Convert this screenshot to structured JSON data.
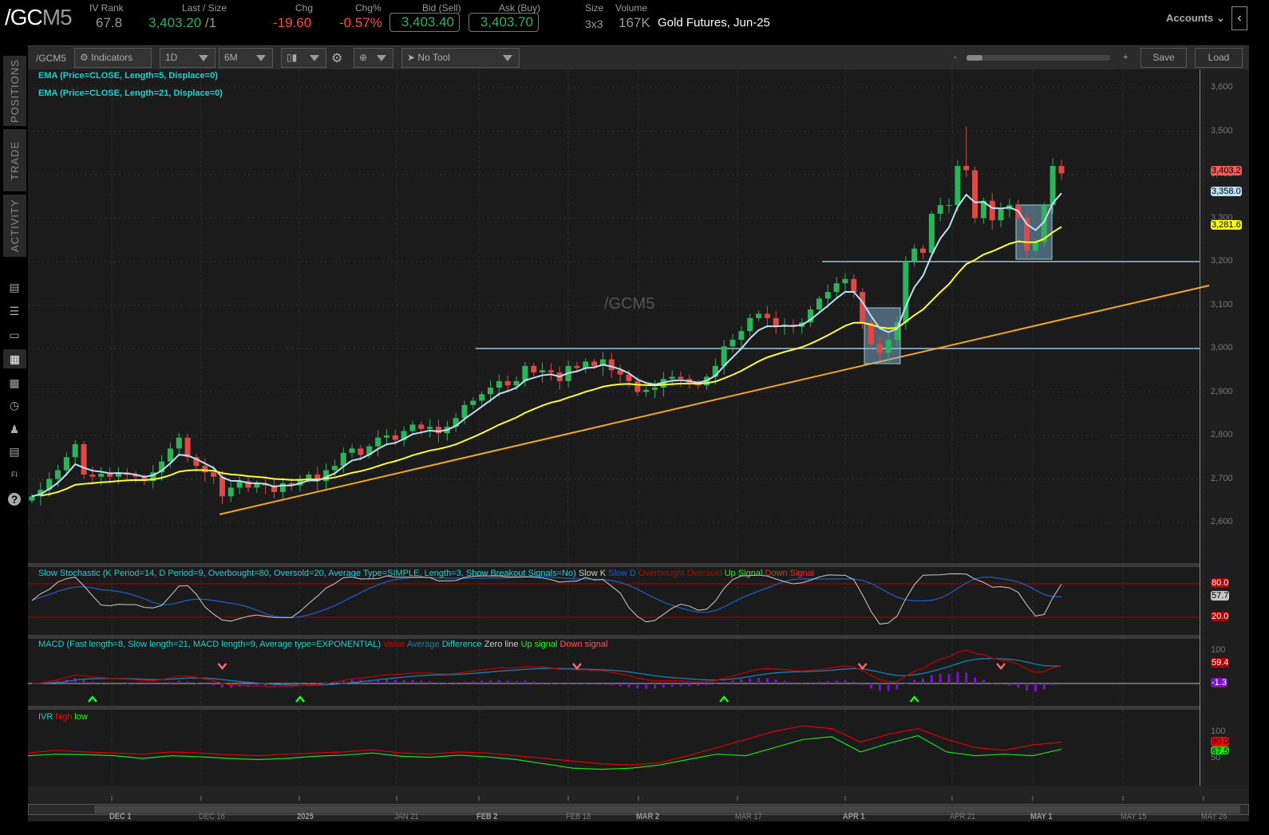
{
  "header": {
    "symbol_main": "/GC",
    "symbol_suffix": "M5",
    "iv_rank_label": "IV Rank",
    "iv_rank": "67.8",
    "last_label": "Last / Size",
    "last": "3,403.20",
    "size": "/1",
    "chg_label": "Chg",
    "chg": "-19.60",
    "chgpct_label": "Chg%",
    "chgpct": "-0.57%",
    "bid_label": "Bid (Sell)",
    "bid": "3,403.40",
    "ask_label": "Ask (Buy)",
    "ask": "3,403.70",
    "sz_label": "Size",
    "sz": "3x3",
    "vol_label": "Volume",
    "vol": "167K",
    "desc": "Gold Futures, Jun-25",
    "accounts": "Accounts"
  },
  "toolbar": {
    "symbol": "/GCM5",
    "indicators": "Indicators",
    "aggregation": "1D",
    "range": "6M",
    "tool": "No Tool",
    "zoom_minus": "-",
    "zoom_plus": "+",
    "save": "Save",
    "load": "Load"
  },
  "sidebar": {
    "tabs": [
      "POSITIONS",
      "TRADE",
      "ACTIVITY"
    ]
  },
  "studies": {
    "ema5": "EMA (Price=CLOSE, Length=5, Displace=0)",
    "ema21": "EMA (Price=CLOSE, Length=21, Displace=0)",
    "watermark": "/GCM5",
    "stoch": "Slow Stochastic (K Period=14, D Period=9, Overbought=80, Oversold=20, Average Type=SIMPLE, Length=3, Show Breakout Signals=No)",
    "stoch_legend": [
      "Slow K",
      "Slow D",
      "Overbought",
      "Oversold",
      "Up Signal",
      "Down Signal"
    ],
    "macd": "MACD (Fast length=8, Slow length=21, MACD length=9, Average type=EXPONENTIAL)",
    "macd_legend": [
      "Value",
      "Average",
      "Difference",
      "Zero line",
      "Up signal",
      "Down signal"
    ],
    "ivr": "IVR",
    "ivr_legend": [
      "high",
      "low"
    ]
  },
  "price_axis": {
    "ticks": [
      "3,600",
      "3,500",
      "3,400",
      "3,300",
      "3,200",
      "3,100",
      "3,000",
      "2,900",
      "2,800",
      "2,700",
      "2,600"
    ],
    "last_tag": "3,403.2",
    "ema5_tag": "3,358.0",
    "ema21_tag": "3,281.6"
  },
  "stoch_axis": {
    "ob": "80.0",
    "k": "57.7",
    "os": "20.0"
  },
  "macd_axis": {
    "top": "100",
    "value": "59.4",
    "diff": "-1.3"
  },
  "ivr_axis": {
    "top": "100",
    "mid": "50",
    "high": "80.0",
    "low": "67.5"
  },
  "x_axis": [
    "DEC 1",
    "DEC 16",
    "2025",
    "JAN 21",
    "FEB 2",
    "FEB 18",
    "MAR 2",
    "MAR 17",
    "APR 1",
    "APR 21",
    "MAY 1",
    "MAY 15",
    "MAY 26"
  ],
  "colors": {
    "up": "#2db35a",
    "down": "#e04848",
    "ema5": "#b8e2f2",
    "ema21": "#ffff33",
    "trend": "#f5a623",
    "level": "#7d9bb0"
  },
  "chart_data": {
    "type": "candlestick",
    "title": "/GCM5 Gold Futures, Jun-25 daily",
    "ylim": [
      2550,
      3650
    ],
    "first_open": 2650,
    "closes": [
      2660,
      2675,
      2700,
      2720,
      2750,
      2780,
      2710,
      2705,
      2712,
      2705,
      2715,
      2710,
      2705,
      2695,
      2715,
      2740,
      2770,
      2795,
      2750,
      2730,
      2715,
      2705,
      2660,
      2680,
      2695,
      2680,
      2690,
      2685,
      2670,
      2690,
      2685,
      2700,
      2710,
      2695,
      2720,
      2730,
      2760,
      2770,
      2755,
      2775,
      2795,
      2800,
      2790,
      2810,
      2825,
      2815,
      2820,
      2805,
      2820,
      2840,
      2870,
      2880,
      2895,
      2910,
      2925,
      2915,
      2925,
      2960,
      2945,
      2950,
      2945,
      2925,
      2960,
      2955,
      2970,
      2960,
      2975,
      2950,
      2940,
      2925,
      2900,
      2905,
      2910,
      2930,
      2935,
      2930,
      2920,
      2915,
      2935,
      2960,
      3005,
      3020,
      3040,
      3070,
      3080,
      3070,
      3050,
      3055,
      3050,
      3060,
      3090,
      3115,
      3130,
      3150,
      3160,
      3130,
      3060,
      3010,
      2990,
      3020,
      3060,
      3200,
      3230,
      3220,
      3310,
      3330,
      3330,
      3420,
      3410,
      3300,
      3340,
      3295,
      3320,
      3330,
      3300,
      3225,
      3245,
      3330,
      3420,
      3403
    ],
    "high_spikes": {
      "108": 3510
    },
    "levels": [
      3000,
      3200
    ],
    "ivr_high": [
      60,
      65,
      62,
      60,
      58,
      62,
      60,
      57,
      55,
      58,
      60,
      62,
      66,
      60,
      58,
      62,
      60,
      55,
      50,
      45,
      40,
      38,
      42,
      55,
      70,
      85,
      100,
      110,
      105,
      80,
      95,
      105,
      85,
      70,
      65,
      75,
      80
    ],
    "ivr_low": [
      55,
      58,
      57,
      55,
      50,
      55,
      53,
      50,
      48,
      50,
      54,
      56,
      60,
      54,
      52,
      56,
      53,
      48,
      40,
      32,
      30,
      32,
      38,
      48,
      58,
      55,
      70,
      85,
      90,
      62,
      78,
      92,
      62,
      55,
      58,
      55,
      67
    ]
  }
}
